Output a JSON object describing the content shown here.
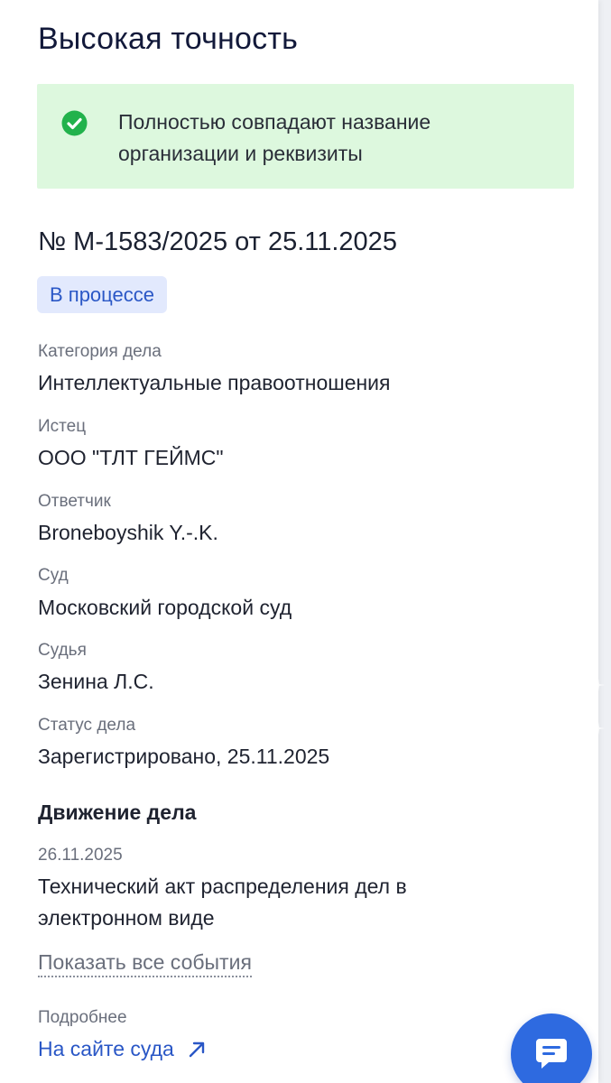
{
  "title": "Высокая точность",
  "alert": {
    "icon": "check-circle-icon",
    "text": "Полностью совпадают название организации и реквизиты",
    "color": "#ddf8de",
    "icon_color": "#22b24c"
  },
  "case": {
    "number": "№ М-1583/2025 от 25.11.2025",
    "status_badge": "В процессе"
  },
  "fields": [
    {
      "label": "Категория дела",
      "value": "Интеллектуальные правоотношения"
    },
    {
      "label": "Истец",
      "value": "ООО \"ТЛТ ГЕЙМС\""
    },
    {
      "label": "Ответчик",
      "value": "Broneboyshik Y.-.K."
    },
    {
      "label": "Суд",
      "value": "Московский городской суд"
    },
    {
      "label": "Судья",
      "value": "Зенина Л.С."
    },
    {
      "label": "Статус дела",
      "value": "Зарегистрировано, 25.11.2025"
    }
  ],
  "movement": {
    "title": "Движение дела",
    "event_date": "26.11.2025",
    "event_text": "Технический акт распределения дел в электронном виде",
    "show_all": "Показать все события"
  },
  "more": {
    "label": "Подробнее",
    "link": "На сайте суда",
    "link_icon": "arrow-up-right-icon"
  },
  "chat_button_icon": "chat-icon",
  "accent_color": "#2a57c6"
}
